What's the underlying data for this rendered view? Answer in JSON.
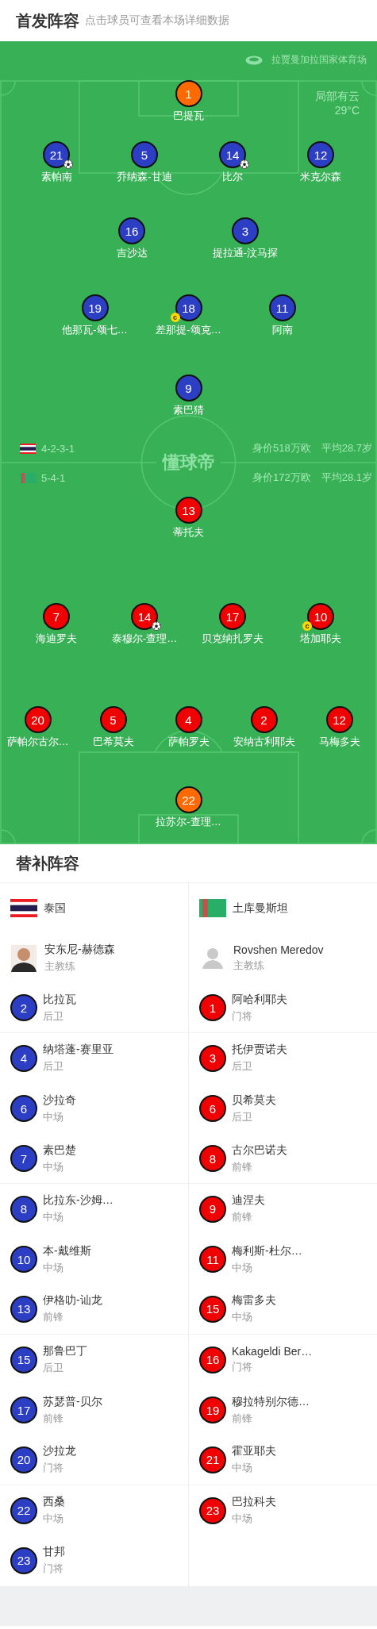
{
  "header": {
    "title": "首发阵容",
    "subtitle": "点击球员可查看本场详细数据"
  },
  "pitch": {
    "stadium": "拉贾曼加拉国家体育场",
    "weather": "局部有云",
    "temperature": "29°C",
    "logo": "懂球帝",
    "teams": [
      {
        "kind": "thailand",
        "formation": "4-2-3-1",
        "value": "身价518万欧",
        "age": "平均28.7岁",
        "color": "#2b3ec4",
        "rows": [
          {
            "kind": "goalkeeper",
            "players": [
              {
                "number": "1",
                "name": "巴提瓦",
                "goal": false
              }
            ]
          },
          {
            "kind": "outfield",
            "players": [
              {
                "number": "21",
                "name": "素帕南",
                "goal": true
              },
              {
                "number": "5",
                "name": "乔纳森-甘迪",
                "goal": false
              },
              {
                "number": "14",
                "name": "比尔",
                "goal": true
              },
              {
                "number": "12",
                "name": "米克尔森",
                "goal": false
              }
            ]
          },
          {
            "kind": "outfield",
            "players": [
              {
                "number": "16",
                "name": "吉沙达",
                "goal": false
              },
              {
                "number": "3",
                "name": "提拉通-汶马探",
                "goal": false
              }
            ]
          },
          {
            "kind": "outfield",
            "players": [
              {
                "number": "19",
                "name": "他那瓦-颂七…",
                "goal": false
              },
              {
                "number": "18",
                "name": "差那提-颂克…",
                "goal": false,
                "badge": "c"
              },
              {
                "number": "11",
                "name": "阿南",
                "goal": false
              }
            ]
          },
          {
            "kind": "outfield",
            "players": [
              {
                "number": "9",
                "name": "素巴猜",
                "goal": false
              }
            ]
          }
        ]
      },
      {
        "kind": "turkmenistan",
        "formation": "5-4-1",
        "value": "身价172万欧",
        "age": "平均28.1岁",
        "color": "#f00000",
        "rows": [
          {
            "kind": "outfield",
            "players": [
              {
                "number": "13",
                "name": "蒂托夫",
                "goal": false
              }
            ]
          },
          {
            "kind": "outfield",
            "players": [
              {
                "number": "7",
                "name": "海迪罗夫",
                "goal": false
              },
              {
                "number": "14",
                "name": "泰穆尔-查理…",
                "goal": true
              },
              {
                "number": "17",
                "name": "贝克纳扎罗夫",
                "goal": false
              },
              {
                "number": "10",
                "name": "塔加耶夫",
                "goal": false,
                "badge": "c"
              }
            ]
          },
          {
            "kind": "outfield",
            "players": [
              {
                "number": "20",
                "name": "萨帕尔古尔…",
                "goal": false
              },
              {
                "number": "5",
                "name": "巴希莫夫",
                "goal": false
              },
              {
                "number": "4",
                "name": "萨帕罗夫",
                "goal": false
              },
              {
                "number": "2",
                "name": "安纳古利耶夫",
                "goal": false
              },
              {
                "number": "12",
                "name": "马梅多夫",
                "goal": false
              }
            ]
          },
          {
            "kind": "goalkeeper",
            "players": [
              {
                "number": "22",
                "name": "拉苏尔-查理…",
                "goal": false
              }
            ]
          }
        ]
      }
    ]
  },
  "substitutes": {
    "title": "替补阵容",
    "teams": [
      {
        "name": "泰国",
        "kind": "thailand",
        "color": "#2b3ec4",
        "coach": {
          "name": "安东尼-赫德森",
          "role": "主教练",
          "photo": true
        },
        "players": [
          {
            "number": "2",
            "name": "比拉瓦",
            "position": "后卫"
          },
          {
            "number": "4",
            "name": "纳塔蓬-赛里亚",
            "position": "后卫"
          },
          {
            "number": "6",
            "name": "沙拉奇",
            "position": "中场"
          },
          {
            "number": "7",
            "name": "素巴楚",
            "position": "中场"
          },
          {
            "number": "8",
            "name": "比拉东-沙姆…",
            "position": "中场"
          },
          {
            "number": "10",
            "name": "本-戴维斯",
            "position": "中场"
          },
          {
            "number": "13",
            "name": "伊格叻-讪龙",
            "position": "前锋"
          },
          {
            "number": "15",
            "name": "那鲁巴丁",
            "position": "后卫"
          },
          {
            "number": "17",
            "name": "苏瑟普-贝尔",
            "position": "前锋"
          },
          {
            "number": "20",
            "name": "沙拉龙",
            "position": "门将"
          },
          {
            "number": "22",
            "name": "西桑",
            "position": "中场"
          },
          {
            "number": "23",
            "name": "甘邦",
            "position": "门将"
          }
        ]
      },
      {
        "name": "土库曼斯坦",
        "kind": "turkmenistan",
        "color": "#f00000",
        "coach": {
          "name": "Rovshen Meredov",
          "role": "主教练",
          "photo": false
        },
        "players": [
          {
            "number": "1",
            "name": "阿哈利耶夫",
            "position": "门将"
          },
          {
            "number": "3",
            "name": "托伊贾诺夫",
            "position": "后卫"
          },
          {
            "number": "6",
            "name": "贝希莫夫",
            "position": "后卫"
          },
          {
            "number": "8",
            "name": "古尔巴诺夫",
            "position": "前锋"
          },
          {
            "number": "9",
            "name": "迪涅夫",
            "position": "前锋"
          },
          {
            "number": "11",
            "name": "梅利斯-杜尔…",
            "position": "中场"
          },
          {
            "number": "15",
            "name": "梅雷多夫",
            "position": "中场"
          },
          {
            "number": "16",
            "name": "Kakageldi Ber…",
            "position": "门将"
          },
          {
            "number": "19",
            "name": "穆拉特别尔德…",
            "position": "前锋"
          },
          {
            "number": "21",
            "name": "霍亚耶夫",
            "position": "中场"
          },
          {
            "number": "23",
            "name": "巴拉科夫",
            "position": "中场"
          }
        ]
      }
    ]
  }
}
